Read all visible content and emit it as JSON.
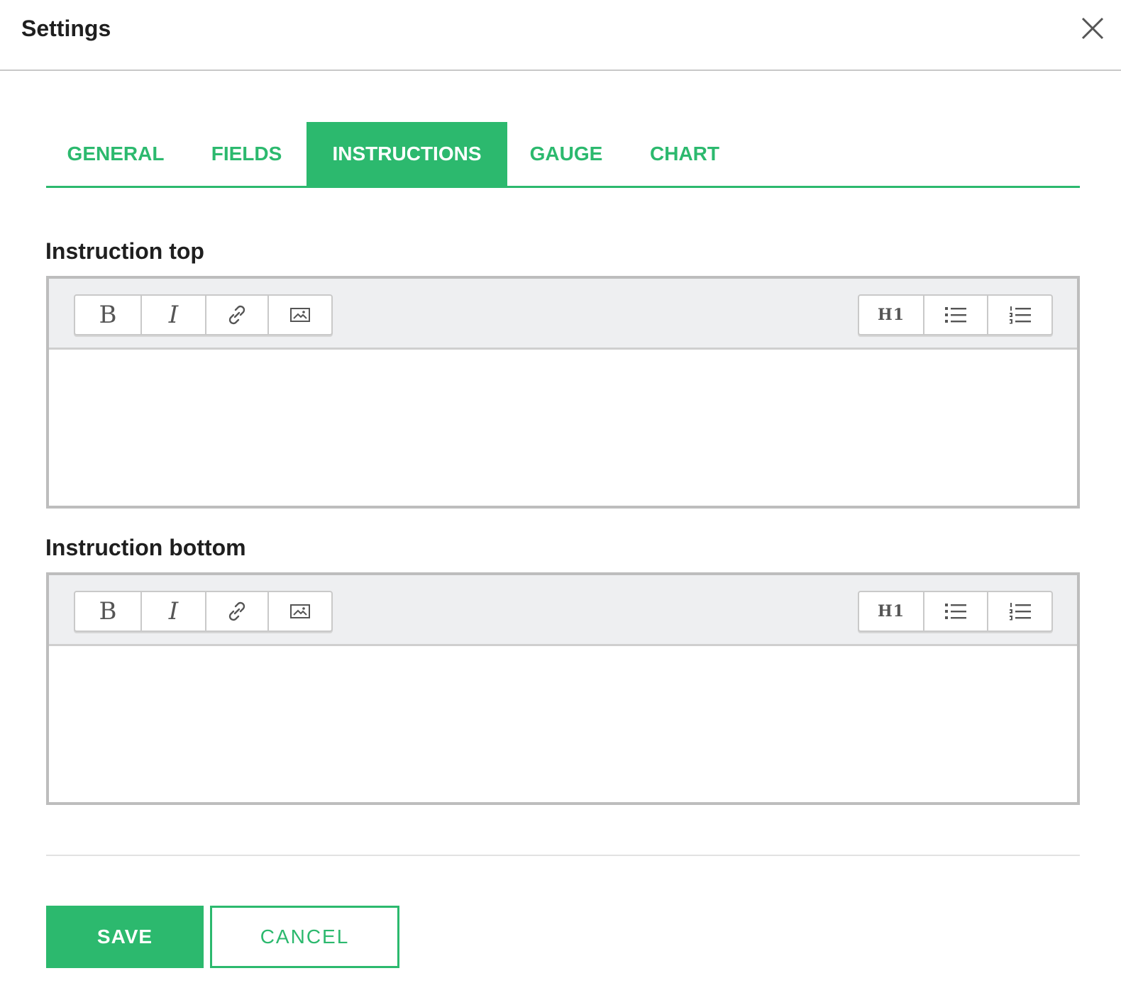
{
  "dialog": {
    "title": "Settings",
    "close_icon": "close-icon"
  },
  "tabs": [
    {
      "label": "GENERAL",
      "active": false
    },
    {
      "label": "FIELDS",
      "active": false
    },
    {
      "label": "INSTRUCTIONS",
      "active": true
    },
    {
      "label": "GAUGE",
      "active": false
    },
    {
      "label": "CHART",
      "active": false
    }
  ],
  "editors": [
    {
      "label": "Instruction top",
      "value": "",
      "toolbar_left": [
        {
          "label": "B",
          "icon": "bold-icon"
        },
        {
          "label": "I",
          "icon": "italic-icon"
        },
        {
          "label": "",
          "icon": "link-icon"
        },
        {
          "label": "",
          "icon": "image-icon"
        }
      ],
      "toolbar_right": [
        {
          "label": "H1",
          "icon": "heading-icon"
        },
        {
          "label": "",
          "icon": "bulleted-list-icon"
        },
        {
          "label": "",
          "icon": "numbered-list-icon"
        }
      ]
    },
    {
      "label": "Instruction bottom",
      "value": "",
      "toolbar_left": [
        {
          "label": "B",
          "icon": "bold-icon"
        },
        {
          "label": "I",
          "icon": "italic-icon"
        },
        {
          "label": "",
          "icon": "link-icon"
        },
        {
          "label": "",
          "icon": "image-icon"
        }
      ],
      "toolbar_right": [
        {
          "label": "H1",
          "icon": "heading-icon"
        },
        {
          "label": "",
          "icon": "bulleted-list-icon"
        },
        {
          "label": "",
          "icon": "numbered-list-icon"
        }
      ]
    }
  ],
  "footer": {
    "save_label": "SAVE",
    "cancel_label": "CANCEL"
  },
  "colors": {
    "accent": "#2cb96e",
    "toolbar_bg": "#eeeff1",
    "border": "#bdbdbd"
  }
}
